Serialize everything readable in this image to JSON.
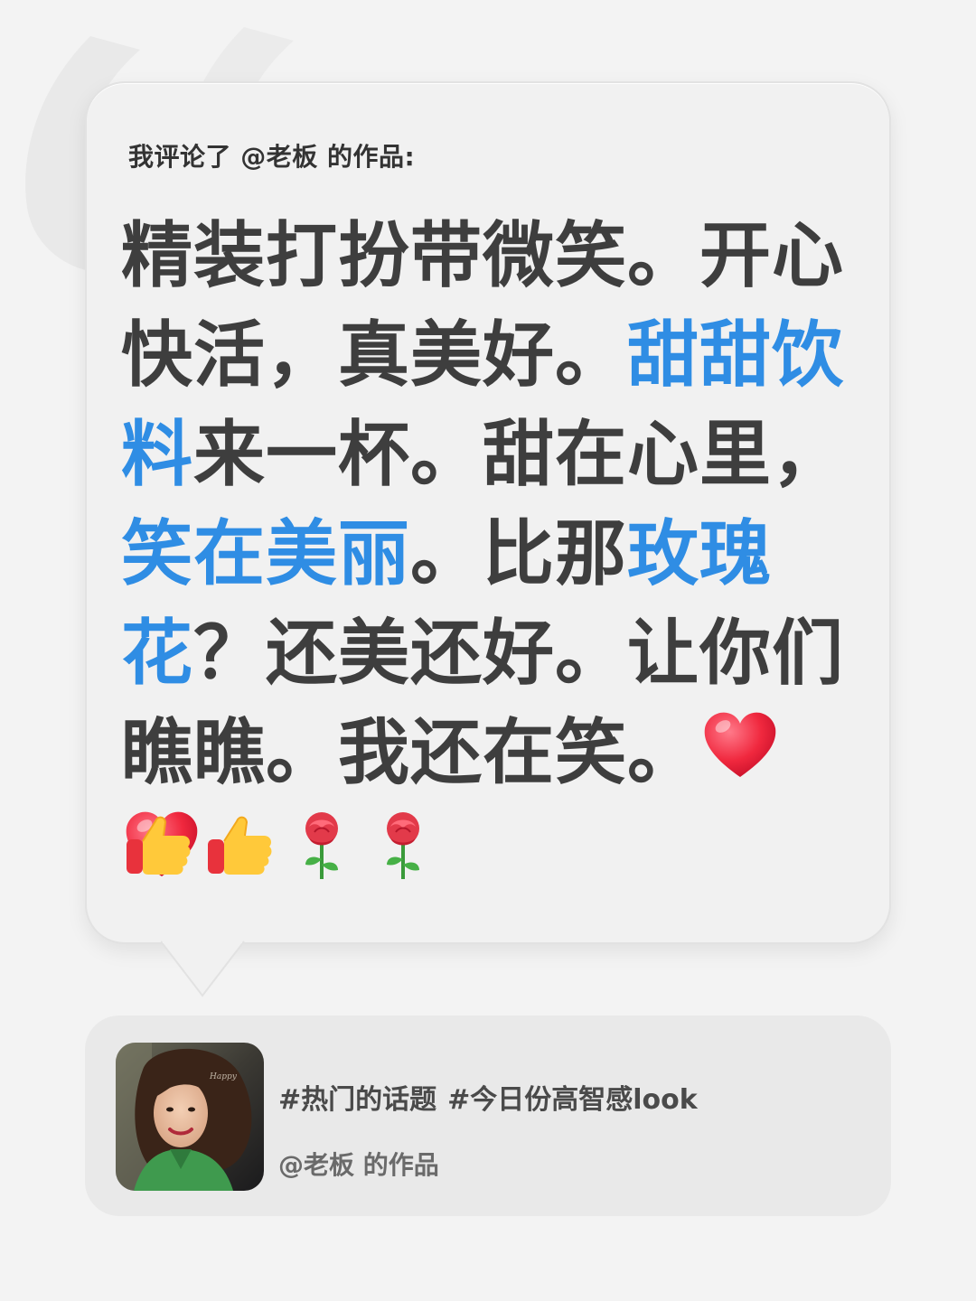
{
  "intro": {
    "prefix": "我评论了",
    "mention": "@老板",
    "suffix": "的作品:"
  },
  "comment": {
    "segments": [
      {
        "text": "精装打扮带微笑。开心快活，真美好。",
        "highlight": false
      },
      {
        "text": "甜甜饮料",
        "highlight": true
      },
      {
        "text": "来一杯。甜在心里，",
        "highlight": false
      },
      {
        "text": "笑在美丽",
        "highlight": true
      },
      {
        "text": "。比那",
        "highlight": false
      },
      {
        "text": "玫瑰花",
        "highlight": true
      },
      {
        "text": "？还美还好。让你们瞧瞧。我还在笑。",
        "highlight": false
      }
    ],
    "trailing_emojis": [
      "red-heart-icon",
      "red-heart-icon"
    ],
    "emoji_row": [
      "thumbs-up-icon",
      "thumbs-up-icon",
      "rose-icon",
      "rose-icon"
    ]
  },
  "card": {
    "tags": [
      "#热门的话题",
      "#今日份高智感look"
    ],
    "byline": "@老板 的作品"
  },
  "colors": {
    "background": "#f3f3f3",
    "bubble": "#f1f1f1",
    "text": "#3e3e3e",
    "highlight": "#2f8de4",
    "card": "#e9e9e9"
  }
}
